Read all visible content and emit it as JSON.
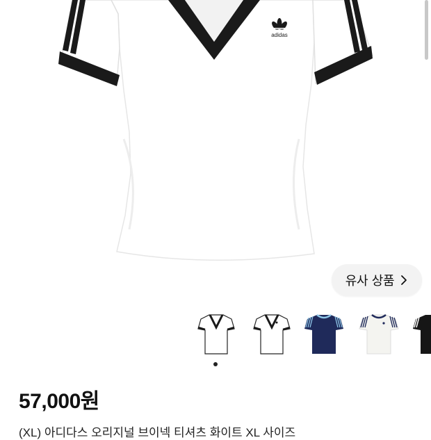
{
  "product": {
    "brand_logo_text": "adidas",
    "price": "57,000원",
    "title": "(XL) 아디다스 오리지널 브이넥 티셔츠 화이트 XL 사이즈"
  },
  "similar_button": {
    "label": "유사 상품",
    "icon": "chevron-right-icon"
  },
  "gallery": {
    "thumbnails": [
      {
        "label": "white v-neck tee",
        "body": "#ffffff",
        "trim": "#1a1a1a"
      },
      {
        "label": "white v-neck tee alt",
        "body": "#ffffff",
        "trim": "#1a1a1a"
      },
      {
        "label": "navy tee",
        "body": "#1f2a5a",
        "trim": "#8fc7e8"
      },
      {
        "label": "white crew tee",
        "body": "#f4f4f0",
        "trim": "#1f2a5a"
      },
      {
        "label": "black tee",
        "body": "#161616",
        "trim": "#ffffff"
      }
    ],
    "page_count": 1,
    "active_index": 0
  },
  "colors": {
    "text": "#111111",
    "button_bg": "#f3f3f3"
  }
}
